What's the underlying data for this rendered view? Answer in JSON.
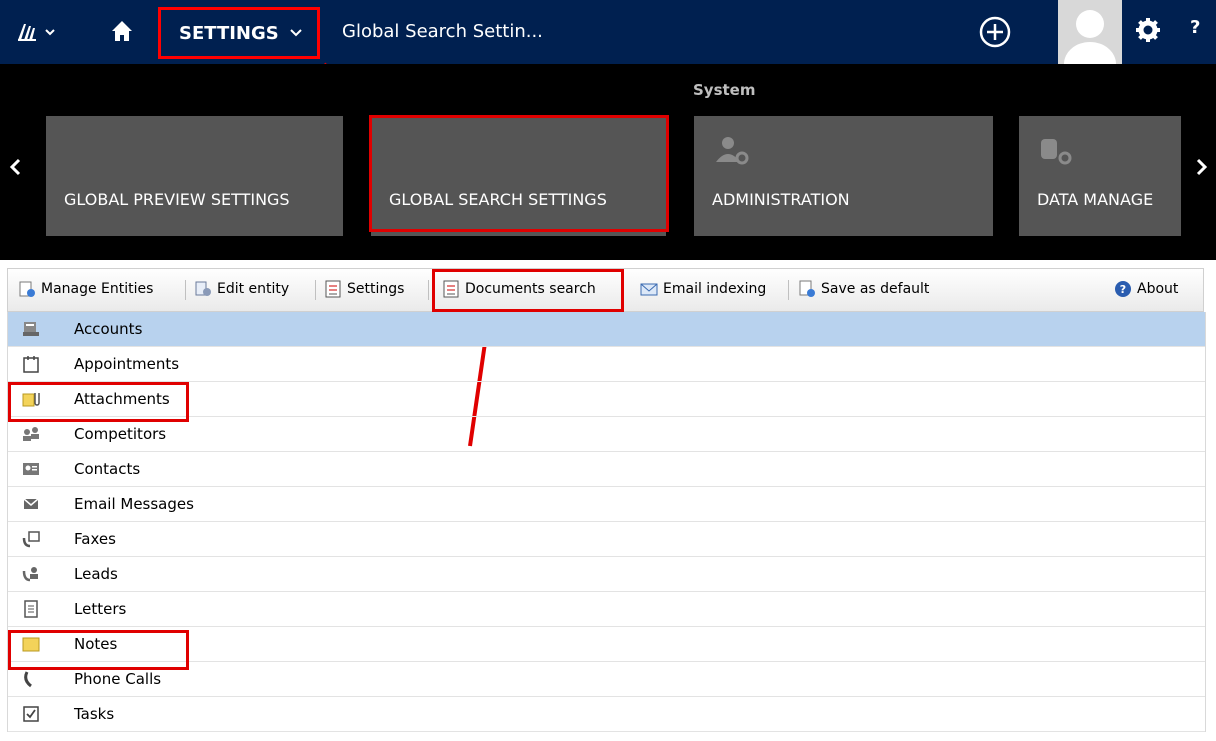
{
  "nav": {
    "settings_label": "SETTINGS",
    "breadcrumb": "Global Search Settin..."
  },
  "ribbon": {
    "group_label": "System",
    "tiles": [
      {
        "label": "GLOBAL PREVIEW SETTINGS"
      },
      {
        "label": "GLOBAL SEARCH SETTINGS"
      },
      {
        "label": "ADMINISTRATION"
      },
      {
        "label": "DATA MANAGE"
      }
    ]
  },
  "toolbar": {
    "manage_entities": "Manage Entities",
    "edit_entity": "Edit entity",
    "settings": "Settings",
    "documents_search": "Documents search",
    "email_indexing": "Email indexing",
    "save_as_default": "Save as default",
    "about": "About"
  },
  "entities": [
    {
      "label": "Accounts",
      "icon": "account-icon"
    },
    {
      "label": "Appointments",
      "icon": "calendar-icon"
    },
    {
      "label": "Attachments",
      "icon": "attachment-icon"
    },
    {
      "label": "Competitors",
      "icon": "competitor-icon"
    },
    {
      "label": "Contacts",
      "icon": "contact-card-icon"
    },
    {
      "label": "Email Messages",
      "icon": "email-icon"
    },
    {
      "label": "Faxes",
      "icon": "fax-icon"
    },
    {
      "label": "Leads",
      "icon": "lead-icon"
    },
    {
      "label": "Letters",
      "icon": "letter-icon"
    },
    {
      "label": "Notes",
      "icon": "note-icon"
    },
    {
      "label": "Phone Calls",
      "icon": "phone-icon"
    },
    {
      "label": "Tasks",
      "icon": "task-icon"
    }
  ],
  "selected_entity": "Accounts",
  "colors": {
    "nav_bg": "#002050",
    "ribbon_bg": "#000000",
    "tile_bg": "#555555",
    "highlight": "#e00000",
    "selected_row": "#b8d2ee"
  }
}
